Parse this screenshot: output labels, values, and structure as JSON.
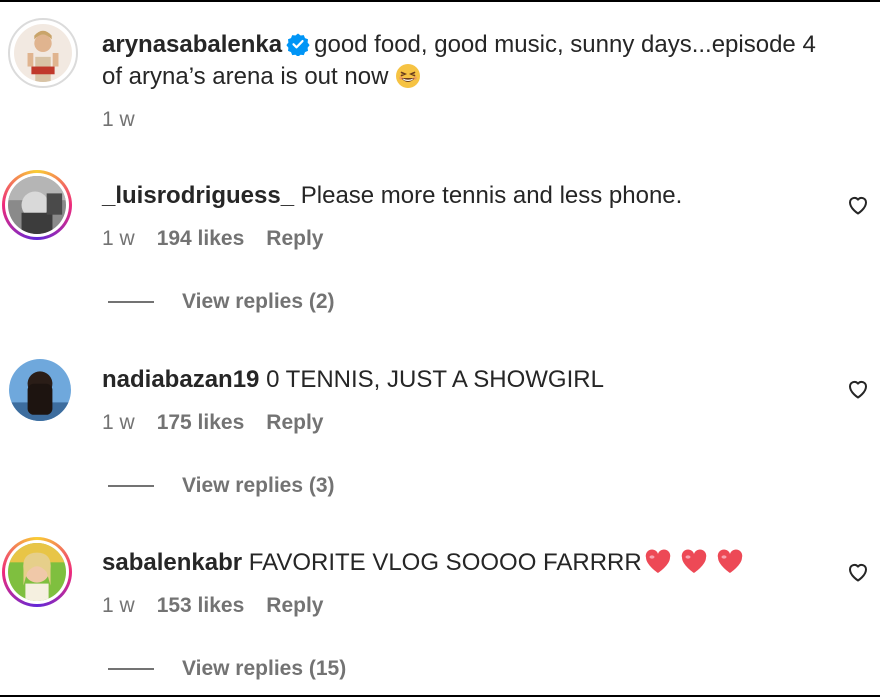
{
  "post": {
    "username": "arynasabalenka",
    "verified": true,
    "caption": "good food, good music, sunny days...episode 4 of aryna’s arena is out now",
    "emoji": "grinning-squinting-face-emoji",
    "time": "1 w"
  },
  "comments": [
    {
      "username": "_luisrodriguess_",
      "text": "Please more tennis and less phone.",
      "time": "1 w",
      "likes": "194 likes",
      "reply_label": "Reply",
      "view_replies": "View replies (2)",
      "avatar_ring": "story"
    },
    {
      "username": "nadiabazan19",
      "text": "0 TENNIS, JUST A SHOWGIRL",
      "time": "1 w",
      "likes": "175 likes",
      "reply_label": "Reply",
      "view_replies": "View replies (3)",
      "avatar_ring": "none"
    },
    {
      "username": "sabalenkabr",
      "text": "FAVORITE VLOG SOOOO FARRRR",
      "trailing_emojis": [
        "red-heart-emoji",
        "red-heart-emoji",
        "red-heart-emoji"
      ],
      "time": "1 w",
      "likes": "153 likes",
      "reply_label": "Reply",
      "view_replies": "View replies (15)",
      "avatar_ring": "story"
    }
  ],
  "colors": {
    "text": "#262626",
    "secondary": "#737373",
    "verified_blue": "#0095f6",
    "heart_red": "#ed4956"
  }
}
